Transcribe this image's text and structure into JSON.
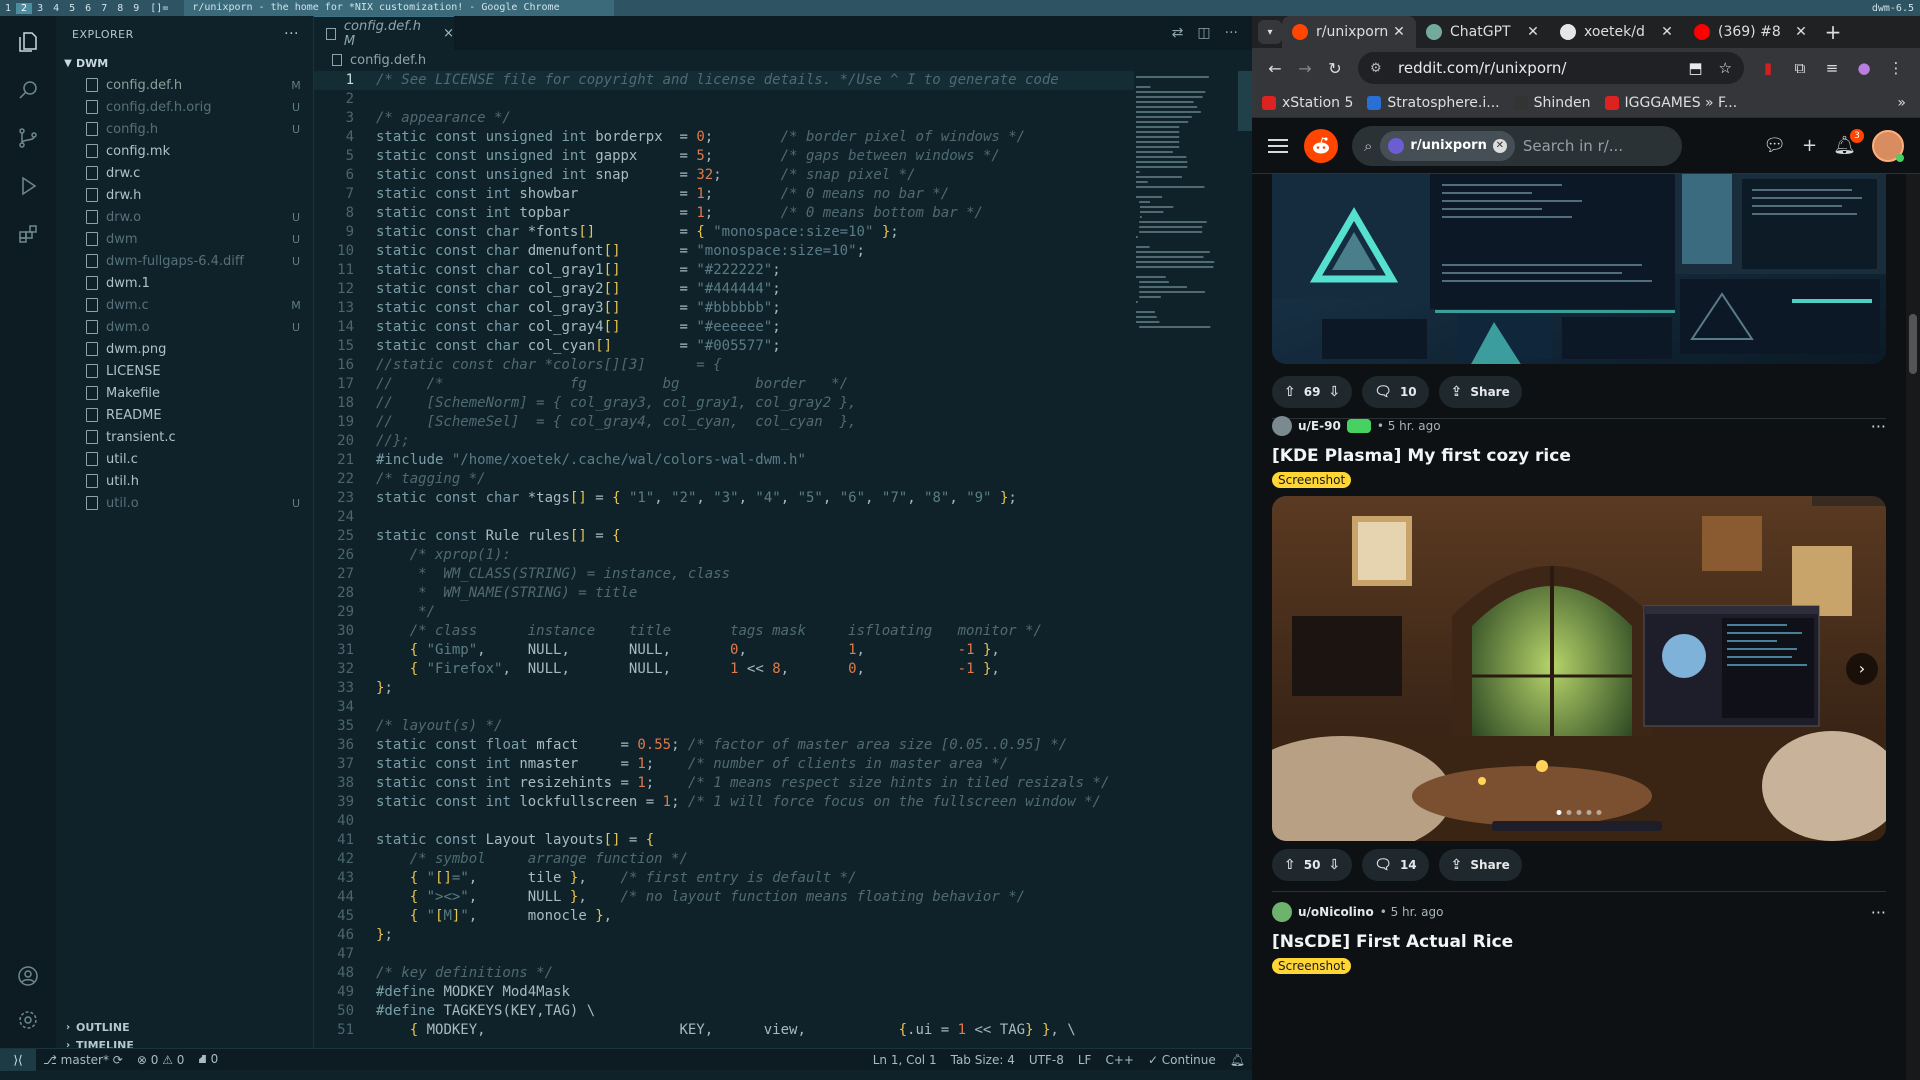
{
  "topbar": {
    "tags": [
      "1",
      "2",
      "3",
      "4",
      "5",
      "6",
      "7",
      "8",
      "9"
    ],
    "selected_tag": "2",
    "layout": "[]=",
    "window_title": "r/unixporn - the home for *NIX customization! - Google Chrome",
    "status_text": "dwm-6.5"
  },
  "vscode": {
    "sidebar": {
      "title": "EXPLORER",
      "more": "···",
      "folder": "DWM",
      "files": [
        {
          "name": "config.def.h",
          "badge": "M",
          "style": "mod"
        },
        {
          "name": "config.def.h.orig",
          "badge": "U",
          "style": "dim"
        },
        {
          "name": "config.h",
          "badge": "U",
          "style": "dim"
        },
        {
          "name": "config.mk",
          "badge": "",
          "style": "normal"
        },
        {
          "name": "drw.c",
          "badge": "",
          "style": "normal"
        },
        {
          "name": "drw.h",
          "badge": "",
          "style": "normal"
        },
        {
          "name": "drw.o",
          "badge": "U",
          "style": "dim"
        },
        {
          "name": "dwm",
          "badge": "U",
          "style": "dim"
        },
        {
          "name": "dwm-fullgaps-6.4.diff",
          "badge": "U",
          "style": "dim"
        },
        {
          "name": "dwm.1",
          "badge": "",
          "style": "normal"
        },
        {
          "name": "dwm.c",
          "badge": "M",
          "style": "dim"
        },
        {
          "name": "dwm.o",
          "badge": "U",
          "style": "dim"
        },
        {
          "name": "dwm.png",
          "badge": "",
          "style": "normal"
        },
        {
          "name": "LICENSE",
          "badge": "",
          "style": "normal"
        },
        {
          "name": "Makefile",
          "badge": "",
          "style": "normal"
        },
        {
          "name": "README",
          "badge": "",
          "style": "normal"
        },
        {
          "name": "transient.c",
          "badge": "",
          "style": "normal"
        },
        {
          "name": "util.c",
          "badge": "",
          "style": "normal"
        },
        {
          "name": "util.h",
          "badge": "",
          "style": "normal"
        },
        {
          "name": "util.o",
          "badge": "U",
          "style": "dim"
        }
      ],
      "outline": "OUTLINE",
      "timeline": "TIMELINE"
    },
    "tab": {
      "label": "config.def.h M",
      "close": "×"
    },
    "breadcrumb": "config.def.h",
    "code_lines": [
      "/* See LICENSE file for copyright and license details. */Use ^ I to generate code",
      "",
      "/* appearance */",
      "static const unsigned int borderpx  = 0;        /* border pixel of windows */",
      "static const unsigned int gappx     = 5;        /* gaps between windows */",
      "static const unsigned int snap      = 32;       /* snap pixel */",
      "static const int showbar            = 1;        /* 0 means no bar */",
      "static const int topbar             = 1;        /* 0 means bottom bar */",
      "static const char *fonts[]          = { \"monospace:size=10\" };",
      "static const char dmenufont[]       = \"monospace:size=10\";",
      "static const char col_gray1[]       = \"#222222\";",
      "static const char col_gray2[]       = \"#444444\";",
      "static const char col_gray3[]       = \"#bbbbbb\";",
      "static const char col_gray4[]       = \"#eeeeee\";",
      "static const char col_cyan[]        = \"#005577\";",
      "//static const char *colors[][3]      = {",
      "//    /*               fg         bg         border   */",
      "//    [SchemeNorm] = { col_gray3, col_gray1, col_gray2 },",
      "//    [SchemeSel]  = { col_gray4, col_cyan,  col_cyan  },",
      "//};",
      "#include \"/home/xoetek/.cache/wal/colors-wal-dwm.h\"",
      "/* tagging */",
      "static const char *tags[] = { \"1\", \"2\", \"3\", \"4\", \"5\", \"6\", \"7\", \"8\", \"9\" };",
      "",
      "static const Rule rules[] = {",
      "    /* xprop(1):",
      "     *  WM_CLASS(STRING) = instance, class",
      "     *  WM_NAME(STRING) = title",
      "     */",
      "    /* class      instance    title       tags mask     isfloating   monitor */",
      "    { \"Gimp\",     NULL,       NULL,       0,            1,           -1 },",
      "    { \"Firefox\",  NULL,       NULL,       1 << 8,       0,           -1 },",
      "};",
      "",
      "/* layout(s) */",
      "static const float mfact     = 0.55; /* factor of master area size [0.05..0.95] */",
      "static const int nmaster     = 1;    /* number of clients in master area */",
      "static const int resizehints = 1;    /* 1 means respect size hints in tiled resizals */",
      "static const int lockfullscreen = 1; /* 1 will force focus on the fullscreen window */",
      "",
      "static const Layout layouts[] = {",
      "    /* symbol     arrange function */",
      "    { \"[]=\",      tile },    /* first entry is default */",
      "    { \"><>\",      NULL },    /* no layout function means floating behavior */",
      "    { \"[M]\",      monocle },",
      "};",
      "",
      "/* key definitions */",
      "#define MODKEY Mod4Mask",
      "#define TAGKEYS(KEY,TAG) \\",
      "    { MODKEY,                       KEY,      view,           {.ui = 1 << TAG} }, \\"
    ],
    "statusbar": {
      "branch": "master*",
      "errors": "0",
      "warnings": "0",
      "ports": "0",
      "position": "Ln 1, Col 1",
      "tabsize": "Tab Size: 4",
      "encoding": "UTF-8",
      "eol": "LF",
      "language": "C++",
      "continue": "✓ Continue"
    }
  },
  "chrome": {
    "tabs": [
      {
        "title": "r/unixporn",
        "favicon_color": "#ff4500",
        "active": true
      },
      {
        "title": "ChatGPT",
        "favicon_color": "#74aa9c",
        "active": false
      },
      {
        "title": "xoetek/d",
        "favicon_color": "#e6e6e6",
        "active": false
      },
      {
        "title": "(369) #8",
        "favicon_color": "#ff0000",
        "active": false
      }
    ],
    "url": "reddit.com/r/unixporn/",
    "bookmarks": [
      {
        "label": "xStation 5",
        "color": "#d22"
      },
      {
        "label": "Stratosphere.i...",
        "color": "#2a6fd6"
      },
      {
        "label": "Shinden",
        "color": "#333"
      },
      {
        "label": "IGGGAMES » F...",
        "color": "#d22"
      }
    ]
  },
  "reddit": {
    "search_chip": "r/unixporn",
    "search_placeholder": "Search in r/...",
    "notif_count": "3",
    "posts": [
      {
        "votes": "69",
        "comments": "10",
        "share": "Share"
      },
      {
        "user": "u/E-90",
        "time": "• 5 hr. ago",
        "title": "[KDE Plasma] My first cozy rice",
        "flair": "Screenshot",
        "votes": "50",
        "comments": "14",
        "share": "Share"
      },
      {
        "user": "u/oNicolino",
        "time": "• 5 hr. ago",
        "title": "[NsCDE] First Actual Rice",
        "flair": "Screenshot"
      }
    ]
  }
}
